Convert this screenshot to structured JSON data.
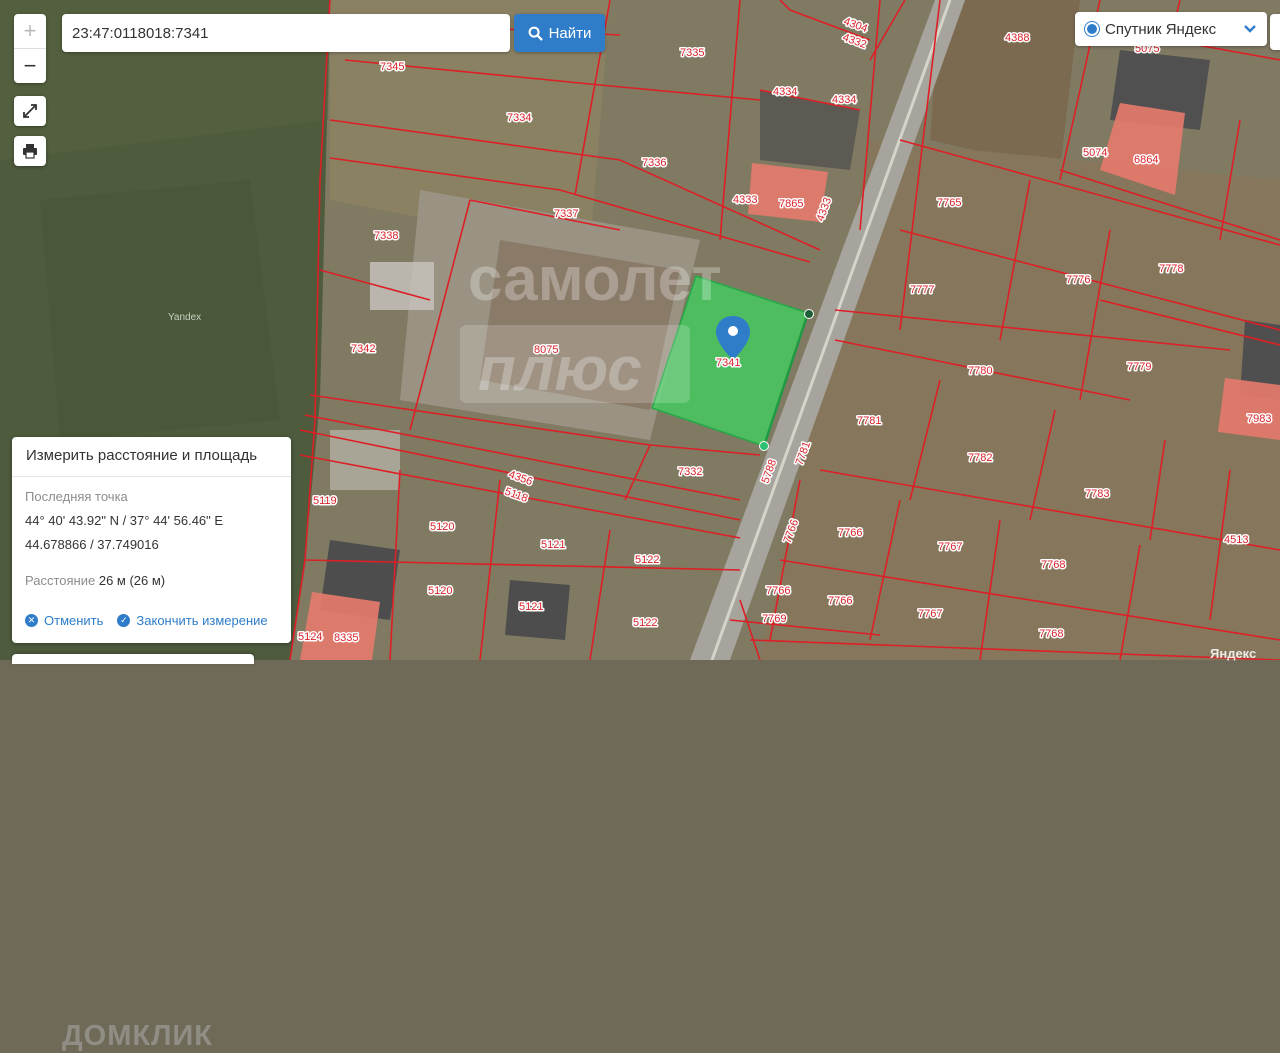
{
  "search": {
    "value": "23:47:0118018:7341",
    "button_label": "Найти"
  },
  "layer": {
    "label": "Спутник Яндекс"
  },
  "map": {
    "selected_parcel": "7341",
    "parcels": [
      "7345",
      "7335",
      "7334",
      "7336",
      "4304",
      "4332",
      "4388",
      "5075",
      "4334",
      "4334",
      "4333",
      "7865",
      "4333",
      "5074",
      "6864",
      "7337",
      "7338",
      "7765",
      "7777",
      "7776",
      "7778",
      "7342",
      "8075",
      "7780",
      "7779",
      "7781",
      "7782",
      "7983",
      "7332",
      "4356",
      "5118",
      "5119",
      "5788",
      "7781",
      "7783",
      "7766",
      "7766",
      "5120",
      "5121",
      "5122",
      "7767",
      "7768",
      "4513",
      "5120",
      "5121",
      "5122",
      "7766",
      "7766",
      "7769",
      "7767",
      "7768",
      "5124",
      "8335"
    ],
    "map_label": "Yandex",
    "watermark_line1": "самолет",
    "watermark_line2": "плюс",
    "attribution": "Яндекс"
  },
  "measure": {
    "title": "Измерить расстояние и площадь",
    "last_point_label": "Последняя точка",
    "coords_dms": "44° 40' 43.92\" N / 37° 44' 56.46\" E",
    "coords_dec": "44.678866 / 37.749016",
    "distance_label": "Расстояние",
    "distance_value": "26 м (26 м)",
    "cancel_label": "Отменить",
    "finish_label": "Закончить измерение",
    "watermark": "ДОМКЛИК"
  }
}
